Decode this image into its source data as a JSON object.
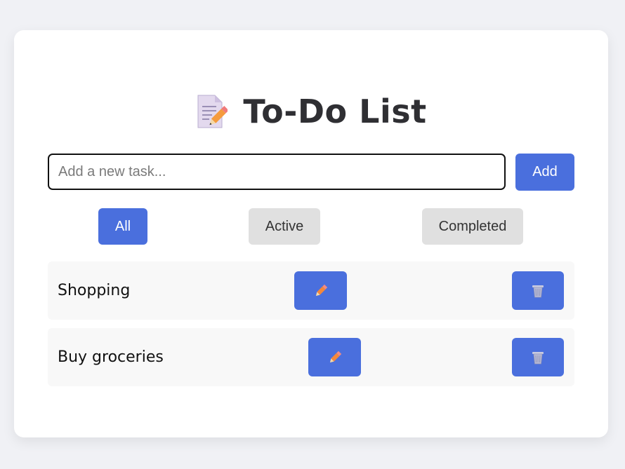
{
  "app": {
    "title": "To-Do List",
    "title_icon": "memo-icon"
  },
  "input": {
    "value": "",
    "placeholder": "Add a new task..."
  },
  "add_button": {
    "label": "Add"
  },
  "filters": [
    {
      "label": "All",
      "selected": true
    },
    {
      "label": "Active",
      "selected": false
    },
    {
      "label": "Completed",
      "selected": false
    }
  ],
  "tasks": [
    {
      "text": "Shopping",
      "edit_icon": "pencil-icon",
      "delete_icon": "trash-icon"
    },
    {
      "text": "Buy groceries",
      "edit_icon": "pencil-icon",
      "delete_icon": "trash-icon"
    }
  ],
  "colors": {
    "accent": "#4a6fdd",
    "filter_idle": "#e0e0e0",
    "background": "#f0f1f5",
    "card": "#ffffff",
    "row": "#f8f8f8"
  }
}
